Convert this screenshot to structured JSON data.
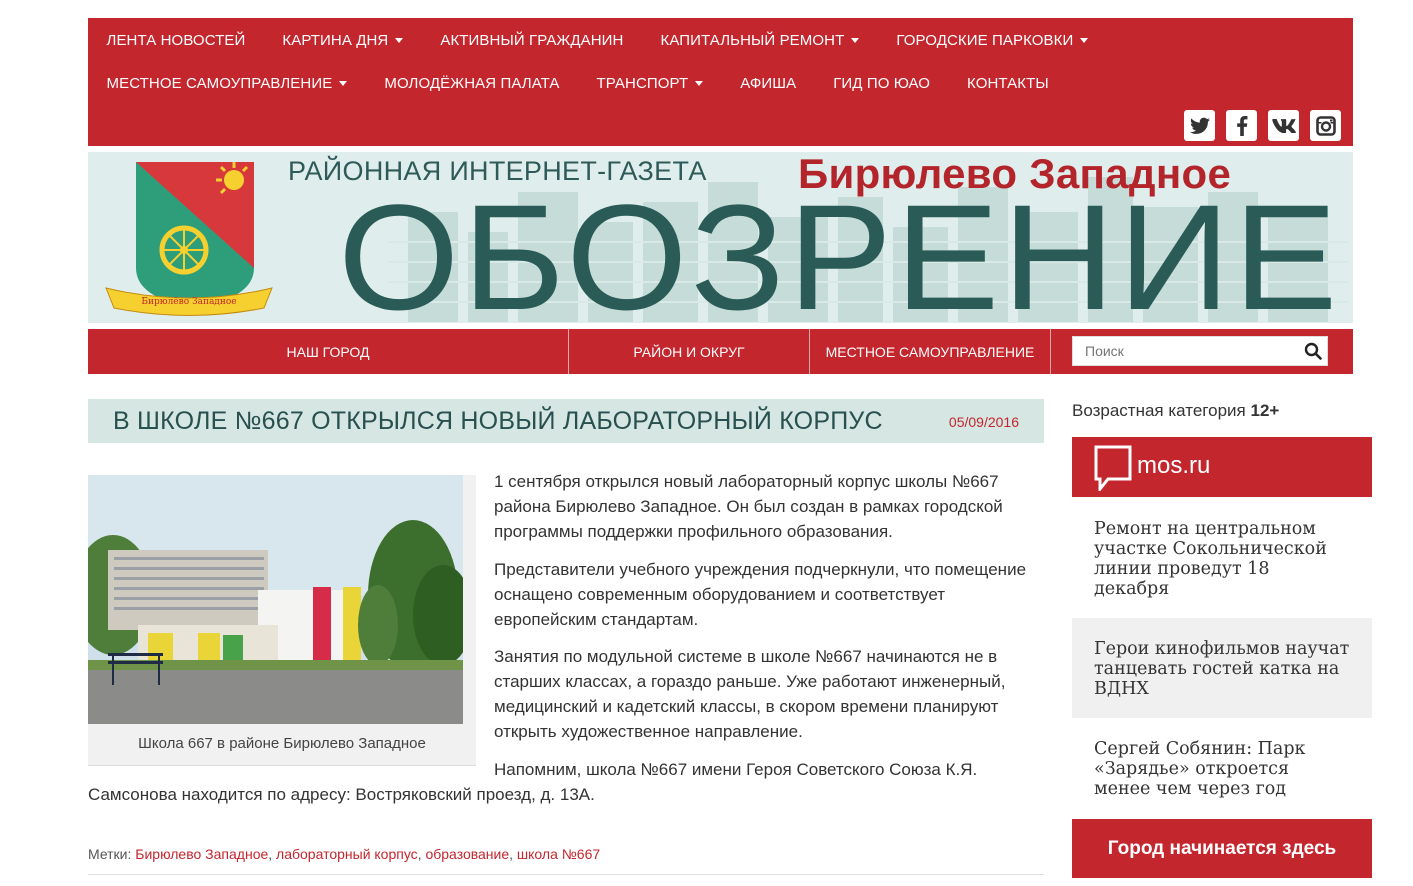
{
  "topnav": {
    "row1": [
      {
        "label": "ЛЕНТА НОВОСТЕЙ",
        "caret": false
      },
      {
        "label": "КАРТИНА ДНЯ",
        "caret": true
      },
      {
        "label": "АКТИВНЫЙ ГРАЖДАНИН",
        "caret": false
      },
      {
        "label": "КАПИТАЛЬНЫЙ РЕМОНТ",
        "caret": true
      },
      {
        "label": "ГОРОДСКИЕ ПАРКОВКИ",
        "caret": true
      }
    ],
    "row2": [
      {
        "label": "МЕСТНОЕ САМОУПРАВЛЕНИЕ",
        "caret": true
      },
      {
        "label": "МОЛОДЁЖНАЯ ПАЛАТА",
        "caret": false
      },
      {
        "label": "ТРАНСПОРТ",
        "caret": true
      },
      {
        "label": "АФИША",
        "caret": false
      },
      {
        "label": "ГИД ПО ЮАО",
        "caret": false
      },
      {
        "label": "КОНТАКТЫ",
        "caret": false
      }
    ],
    "social_icons": [
      "twitter-icon",
      "facebook-icon",
      "vk-icon",
      "instagram-icon"
    ]
  },
  "banner": {
    "subtitle": "РАЙОННАЯ ИНТЕРНЕТ-ГАЗЕТА",
    "brand": "Бирюлево Западное",
    "big_title": "ОБОЗРЕНИЕ",
    "crest_ribbon": "Бирюлёво Западное"
  },
  "secnav": {
    "items": [
      "НАШ ГОРОД",
      "РАЙОН И ОКРУГ",
      "МЕСТНОЕ САМОУПРАВЛЕНИЕ"
    ],
    "search_placeholder": "Поиск"
  },
  "article": {
    "title": "В ШКОЛЕ №667 ОТКРЫЛСЯ НОВЫЙ ЛАБОРАТОРНЫЙ КОРПУС",
    "date": "05/09/2016",
    "caption": "Школа 667 в районе Бирюлево Западное",
    "paragraphs": [
      "1 сентября открылся новый лабораторный корпус школы №667 района Бирюлево Западное. Он был создан в рамках городской программы поддержки профильного образования.",
      "Представители учебного учреждения подчеркнули, что помещение оснащено современным оборудованием и соответствует европейским стандартам.",
      "Занятия по модульной системе в школе №667 начинаются не в старших классах, а гораздо раньше. Уже работают инженерный, медицинский и кадетский классы, в скором времени планируют открыть художественное направление.",
      "Напомним, школа №667 имени Героя Советского Союза К.Я. Самсонова находится по адресу: Востряковский проезд, д. 13А."
    ],
    "tags_label": "Метки:",
    "tags": [
      "Бирюлево Западное",
      "лабораторный корпус",
      "образование",
      "школа №667"
    ]
  },
  "sidebar": {
    "age_label": "Возрастная категория",
    "age_value": "12+",
    "mos_label": "mos.ru",
    "news": [
      "Ремонт на центральном участке Сокольнической линии проведут 18 декабря",
      "Герои кинофильмов научат танцевать гостей катка на ВДНХ",
      "Сергей Собянин: Парк «Зарядье» откроется менее чем через год"
    ],
    "city_button": "Город начинается здесь"
  },
  "colors": {
    "brand_red": "#c4262e",
    "teal_dark": "#2b5b57",
    "title_bg": "#d5e6e3"
  }
}
